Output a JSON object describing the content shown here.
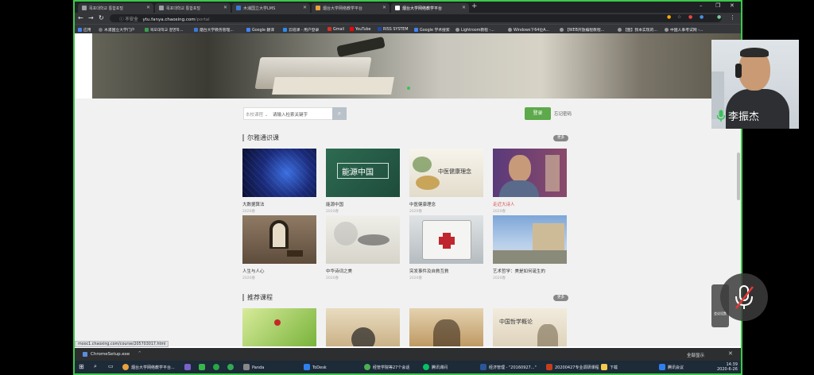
{
  "tabs": [
    {
      "label": "목포대학교 통합포털"
    },
    {
      "label": "목포대학교 통합포털"
    },
    {
      "label": "木浦国立大学LMS"
    },
    {
      "label": "烟台大学网络教学平台"
    },
    {
      "label": "烟台大学网络教学平台"
    }
  ],
  "nav": {
    "insecure": "不安全",
    "host": "ytu.fanya.chaoxing.com",
    "path": "/portal"
  },
  "bookmarks": [
    {
      "label": "应用",
      "color": "#4285f4"
    },
    {
      "label": "木浦国立大学门户",
      "color": "#777"
    },
    {
      "label": "목포대학교 결영학...",
      "color": "#3a9e4c"
    },
    {
      "label": "烟台大学教务管理...",
      "color": "#3a7bd5"
    },
    {
      "label": "Google 翻译",
      "color": "#4285f4"
    },
    {
      "label": "云班课 - 用户登录",
      "color": "#2d8cf0"
    },
    {
      "label": "Gmail",
      "color": "#d93025"
    },
    {
      "label": "YouTube",
      "color": "#ff0000"
    },
    {
      "label": "RISS SYSTEM",
      "color": "#1c4aa0"
    },
    {
      "label": "Google 学术搜索",
      "color": "#4285f4"
    },
    {
      "label": "Lightroom教程 -...",
      "color": "#999"
    },
    {
      "label": "Windows下64位A...",
      "color": "#999"
    },
    {
      "label": "【WEB开放编程教程...",
      "color": "#999"
    },
    {
      "label": "【图】我本实现的...",
      "color": "#999"
    },
    {
      "label": "中国人事考试网 -...",
      "color": "#999"
    }
  ],
  "search": {
    "scope": "本校课程",
    "placeholder": "请输入检索关键字"
  },
  "login_label": "登录",
  "forgot_label": "忘记密码",
  "section1": {
    "title": "尔雅通识课",
    "more": "更多",
    "courses": [
      {
        "title": "大数据算法",
        "year": "2020春",
        "highlight": false
      },
      {
        "title": "能源中国",
        "year": "2020春",
        "highlight": false,
        "img_text": "能源中国"
      },
      {
        "title": "中医健康理念",
        "year": "2020春",
        "highlight": false,
        "img_text": "中医健康理念"
      },
      {
        "title": "走近大诗人",
        "year": "2020春",
        "highlight": true
      },
      {
        "title": "人生与人心",
        "year": "2020春",
        "highlight": false
      },
      {
        "title": "中华诗词之美",
        "year": "2020春",
        "highlight": false
      },
      {
        "title": "突发事件及自救互救",
        "year": "2020春",
        "highlight": false
      },
      {
        "title": "艺术哲学：美是如何诞生的",
        "year": "2020春",
        "highlight": false
      }
    ]
  },
  "section2": {
    "title": "推荐课程",
    "more": "更多",
    "img_texts": [
      "",
      "",
      "",
      "中国哲学概论"
    ]
  },
  "statusbar_link": "mooc1.chaoxing.com/course/205703017.html",
  "download": {
    "file": "ChromeSetup.exe",
    "show_all": "全部显示"
  },
  "taskbar": [
    {
      "label": "烟台大学网络教学平台...",
      "color": "#e8a33d"
    },
    {
      "label": "",
      "color": "#7b62c9"
    },
    {
      "label": "",
      "color": "#39b54a"
    },
    {
      "label": "",
      "color": "#28a745"
    },
    {
      "label": "",
      "color": "#34a853"
    },
    {
      "label": "Panda",
      "color": "#888"
    },
    {
      "label": "ToDesk",
      "color": "#2f80ed"
    },
    {
      "label": "经管学院等27个会话",
      "color": "#4caf50"
    },
    {
      "label": "腾讯课间",
      "color": "#07c160"
    },
    {
      "label": "经济管理 - \"20160927...\"",
      "color": "#2b579a"
    },
    {
      "label": "20200427专业调研课程",
      "color": "#c43e1c"
    },
    {
      "label": "下载",
      "color": "#f2c94c"
    },
    {
      "label": "腾讯会议",
      "color": "#2f80ed"
    }
  ],
  "clock": {
    "time": "14:39",
    "date": "2020-6-26"
  },
  "participant": {
    "name": "李振杰"
  },
  "mute_panel_label": "会议设置"
}
